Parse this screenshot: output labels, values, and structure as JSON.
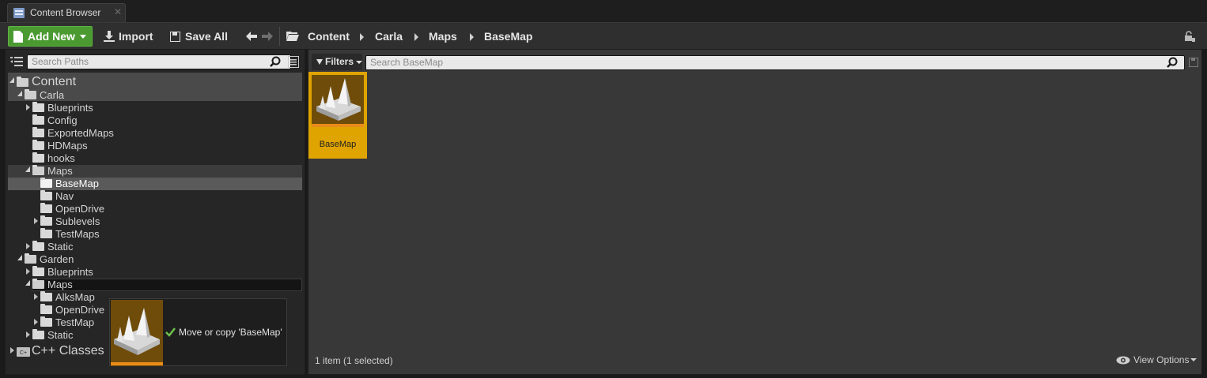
{
  "window": {
    "tab_title": "Content Browser",
    "tab_close": "✕"
  },
  "toolbar": {
    "add_new": "Add New",
    "import": "Import",
    "save_all": "Save All"
  },
  "breadcrumb": [
    "Content",
    "Carla",
    "Maps",
    "BaseMap"
  ],
  "left_pane": {
    "search_placeholder": "Search Paths",
    "tree": [
      {
        "label": "Content",
        "depth": 0,
        "expanded": true,
        "root": true
      },
      {
        "label": "Carla",
        "depth": 1,
        "expanded": true
      },
      {
        "label": "Blueprints",
        "depth": 2,
        "has_children": true
      },
      {
        "label": "Config",
        "depth": 2
      },
      {
        "label": "ExportedMaps",
        "depth": 2
      },
      {
        "label": "HDMaps",
        "depth": 2
      },
      {
        "label": "hooks",
        "depth": 2
      },
      {
        "label": "Maps",
        "depth": 2,
        "expanded": true
      },
      {
        "label": "BaseMap",
        "depth": 3,
        "selected": true
      },
      {
        "label": "Nav",
        "depth": 3
      },
      {
        "label": "OpenDrive",
        "depth": 3
      },
      {
        "label": "Sublevels",
        "depth": 3,
        "has_children": true
      },
      {
        "label": "TestMaps",
        "depth": 3
      },
      {
        "label": "Static",
        "depth": 2,
        "has_children": true
      },
      {
        "label": "Garden",
        "depth": 1,
        "expanded": true
      },
      {
        "label": "Blueprints",
        "depth": 2,
        "has_children": true
      },
      {
        "label": "Maps",
        "depth": 2,
        "expanded": true,
        "drop_target": true
      },
      {
        "label": "AlksMap",
        "depth": 3,
        "has_children": true
      },
      {
        "label": "OpenDrive",
        "depth": 3
      },
      {
        "label": "TestMap",
        "depth": 3,
        "has_children": true
      },
      {
        "label": "Static",
        "depth": 2,
        "has_children": true
      },
      {
        "label": "C++ Classes",
        "depth": 0,
        "root": true,
        "has_children": true
      }
    ]
  },
  "right_pane": {
    "filters_label": "Filters",
    "search_placeholder": "Search BaseMap",
    "assets": [
      {
        "label": "BaseMap",
        "selected": true
      }
    ],
    "status": "1 item (1 selected)",
    "view_options": "View Options"
  },
  "drag_tooltip": {
    "text": "Move or copy 'BaseMap'"
  },
  "colors": {
    "add_new_green": "#4a9a31",
    "asset_selected": "#e0a400",
    "asset_thumb_bar": "#e98b1a"
  }
}
